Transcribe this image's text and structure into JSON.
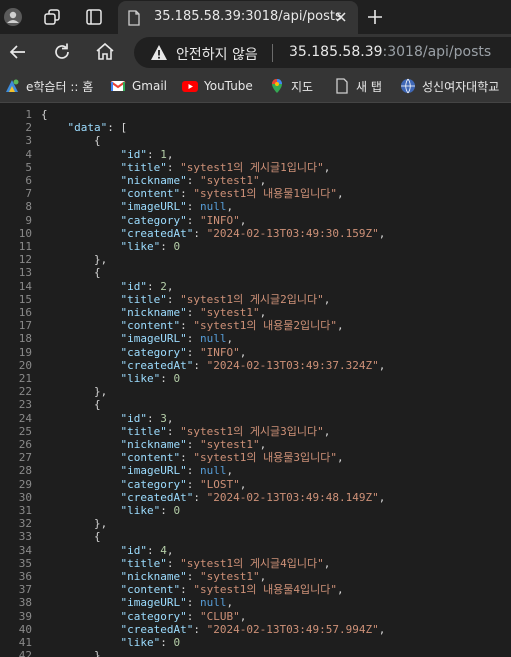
{
  "browser": {
    "tab": {
      "title": "35.185.58.39:3018/api/posts"
    },
    "address_bar": {
      "security_label": "안전하지 않음",
      "url_host": "35.185.58.39",
      "url_rest": ":3018/api/posts"
    },
    "bookmarks": [
      {
        "label": "e학습터 :: 홈",
        "icon": "elearning-icon"
      },
      {
        "label": "Gmail",
        "icon": "gmail-icon"
      },
      {
        "label": "YouTube",
        "icon": "youtube-icon"
      },
      {
        "label": "지도",
        "icon": "maps-icon"
      },
      {
        "label": "새 탭",
        "icon": "new-tab-bookmark-icon"
      },
      {
        "label": "성신여자대학교",
        "icon": "university-icon"
      }
    ]
  },
  "json_view": {
    "posts": [
      {
        "id": "1",
        "title": "sytest1의 게시글1입니다",
        "nickname": "sytest1",
        "content": "sytest1의 내용물1입니다",
        "imageURL": "null",
        "category": "INFO",
        "createdAt": "2024-02-13T03:49:30.159Z",
        "like": "0"
      },
      {
        "id": "2",
        "title": "sytest1의 게시글2입니다",
        "nickname": "sytest1",
        "content": "sytest1의 내용물2입니다",
        "imageURL": "null",
        "category": "INFO",
        "createdAt": "2024-02-13T03:49:37.324Z",
        "like": "0"
      },
      {
        "id": "3",
        "title": "sytest1의 게시글3입니다",
        "nickname": "sytest1",
        "content": "sytest1의 내용물3입니다",
        "imageURL": "null",
        "category": "LOST",
        "createdAt": "2024-02-13T03:49:48.149Z",
        "like": "0"
      },
      {
        "id": "4",
        "title": "sytest1의 게시글4입니다",
        "nickname": "sytest1",
        "content": "sytest1의 내용물4입니다",
        "imageURL": "null",
        "category": "CLUB",
        "createdAt": "2024-02-13T03:49:57.994Z",
        "like": "0"
      }
    ]
  },
  "colors": {
    "key": "#9cdcfe",
    "string": "#ce9178",
    "number": "#b5cea8",
    "null": "#569cd6",
    "line_number": "#8a8a8a"
  }
}
